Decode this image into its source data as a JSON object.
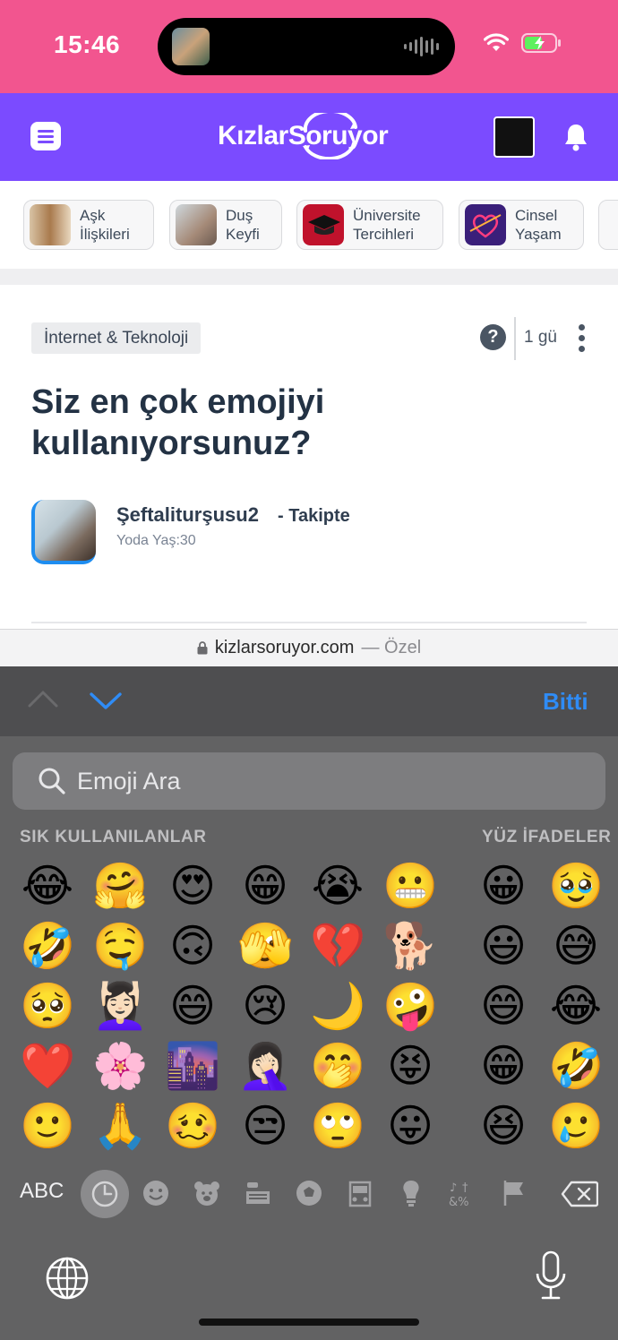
{
  "status_bar": {
    "time": "15:46",
    "colors": {
      "background": "#f2558f"
    }
  },
  "nav": {
    "logo": "KızlarSoruyor",
    "background": "#7b4bff"
  },
  "categories": [
    {
      "label": "Aşk\nİlişkileri",
      "thumb_icon": "couple-photo"
    },
    {
      "label": "Duş\nKeyfi",
      "thumb_icon": "woman-shower-photo"
    },
    {
      "label": "Üniversite\nTercihleri",
      "thumb_icon": "graduation-cap-icon"
    },
    {
      "label": "Cinsel\nYaşam",
      "thumb_icon": "heart-arrow-icon"
    }
  ],
  "question": {
    "tag": "İnternet & Teknoloji",
    "help_symbol": "?",
    "time_ago": "1 gü",
    "title": "Siz en çok emojiyi kullanıyorsunuz?",
    "author": {
      "name": "Şeftaliturşusu2",
      "follow_status": "- Takipte",
      "meta": "Yoda Yaş:30"
    }
  },
  "browser": {
    "url": "kizlarsoruyor.com",
    "private_label": "— Özel"
  },
  "keyboard_accessory": {
    "done_label": "Bitti",
    "accent": "#2f8cf6"
  },
  "emoji_keyboard": {
    "search_placeholder": "Emoji Ara",
    "section_frequent": "SIK KULLANILANLAR",
    "section_faces": "YÜZ İFADELER",
    "frequent_rows": [
      [
        "😂",
        "🤗",
        "😍",
        "😁",
        "😭",
        "😬"
      ],
      [
        "🤣",
        "🤤",
        "🙃",
        "🫣",
        "💔",
        "🐕"
      ],
      [
        "🥺",
        "💆🏻‍♀️",
        "😄",
        "😢",
        "🌙",
        "🤪"
      ],
      [
        "❤️",
        "🌸",
        "🌆",
        "🤦🏻‍♀️",
        "🤭",
        "😝"
      ],
      [
        "🙂",
        "🙏",
        "🥴",
        "😒",
        "🙄",
        "😛"
      ]
    ],
    "faces_rows": [
      [
        "😀",
        "🥹"
      ],
      [
        "😃",
        "😅"
      ],
      [
        "😄",
        "😂"
      ],
      [
        "😁",
        "🤣"
      ],
      [
        "😆",
        "🥲"
      ]
    ],
    "abc_label": "ABC",
    "category_icons": [
      "recent-icon",
      "smiley-icon",
      "bear-icon",
      "food-icon",
      "ball-icon",
      "car-icon",
      "bulb-icon",
      "symbols-icon",
      "flag-icon"
    ]
  }
}
